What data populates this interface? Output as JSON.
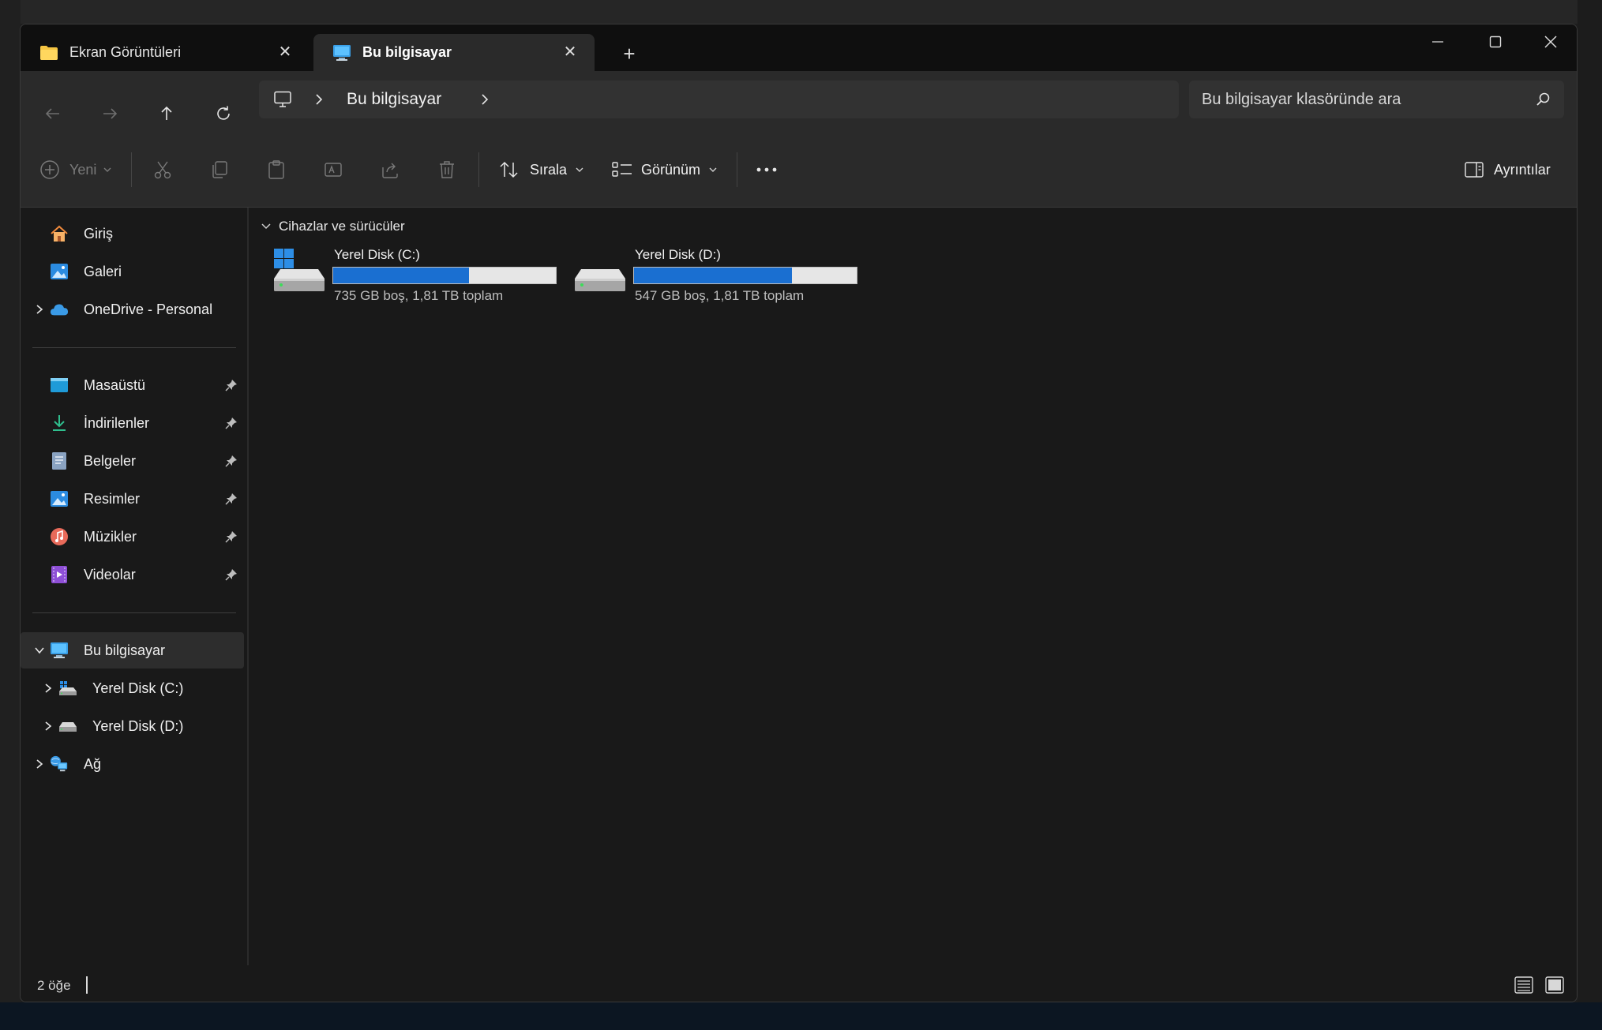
{
  "tabs": [
    {
      "label": "Ekran Görüntüleri",
      "icon": "folder-icon",
      "active": false
    },
    {
      "label": "Bu bilgisayar",
      "icon": "computer-icon",
      "active": true
    }
  ],
  "address": {
    "path": [
      "Bu bilgisayar"
    ]
  },
  "search": {
    "placeholder": "Bu bilgisayar klasöründe ara"
  },
  "toolbar": {
    "new_label": "Yeni",
    "sort_label": "Sırala",
    "view_label": "Görünüm",
    "details_label": "Ayrıntılar"
  },
  "sidebar": {
    "top_items": [
      {
        "label": "Giriş",
        "icon": "home-icon"
      },
      {
        "label": "Galeri",
        "icon": "gallery-icon"
      },
      {
        "label": "OneDrive - Personal",
        "icon": "onedrive-icon"
      }
    ],
    "pinned": [
      {
        "label": "Masaüstü",
        "icon": "desktop-icon"
      },
      {
        "label": "İndirilenler",
        "icon": "download-icon"
      },
      {
        "label": "Belgeler",
        "icon": "documents-icon"
      },
      {
        "label": "Resimler",
        "icon": "pictures-icon"
      },
      {
        "label": "Müzikler",
        "icon": "music-icon"
      },
      {
        "label": "Videolar",
        "icon": "videos-icon"
      }
    ],
    "this_pc": {
      "label": "Bu bilgisayar",
      "icon": "computer-icon"
    },
    "drives": [
      {
        "label": "Yerel Disk (C:)",
        "icon": "windows-drive-icon"
      },
      {
        "label": "Yerel Disk (D:)",
        "icon": "drive-icon"
      }
    ],
    "network": {
      "label": "Ağ",
      "icon": "network-icon"
    }
  },
  "content": {
    "group_label": "Cihazlar ve sürücüler",
    "drives": [
      {
        "name": "Yerel Disk (C:)",
        "info": "735 GB boş, 1,81 TB toplam",
        "used_fraction": 0.61,
        "icon": "windows-drive-icon"
      },
      {
        "name": "Yerel Disk (D:)",
        "info": "547 GB boş, 1,81 TB toplam",
        "used_fraction": 0.71,
        "icon": "drive-icon"
      }
    ]
  },
  "status": {
    "item_count": "2 öğe"
  },
  "colors": {
    "accent": "#1a6fd1",
    "background": "#191919",
    "toolbar": "#2a2a2a"
  }
}
